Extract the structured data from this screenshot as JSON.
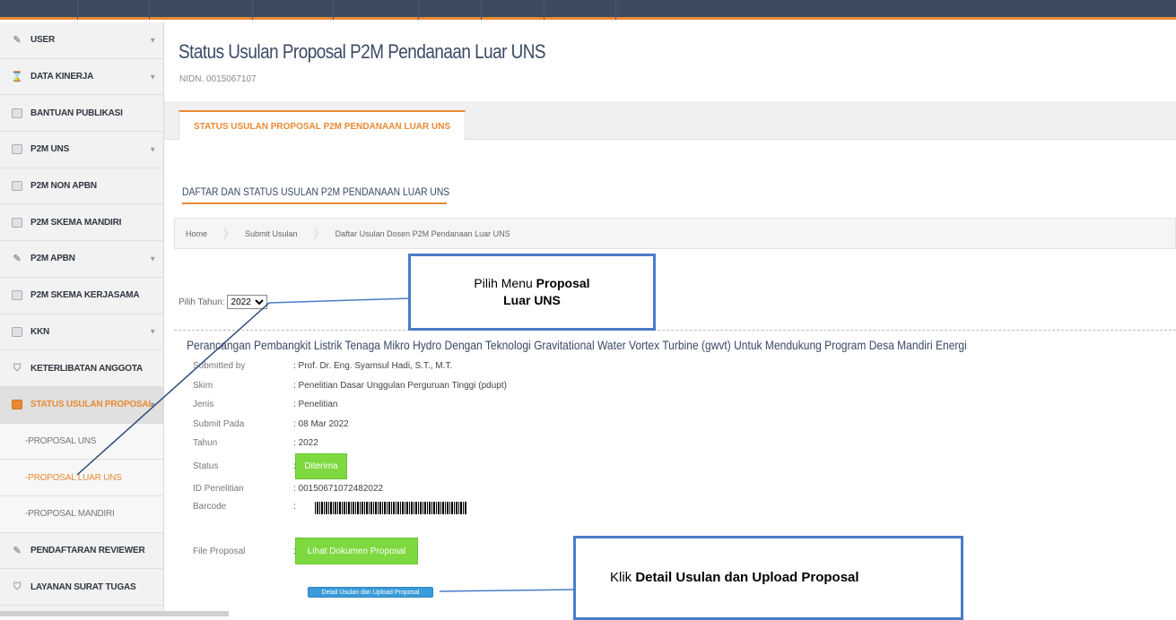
{
  "sidebar": {
    "items": [
      {
        "label": "USER",
        "icon": "pencil-icon",
        "chevron": true
      },
      {
        "label": "DATA KINERJA",
        "icon": "hourglass-icon",
        "chevron": true
      },
      {
        "label": "BANTUAN PUBLIKASI",
        "icon": "document-icon",
        "chevron": false
      },
      {
        "label": "P2M UNS",
        "icon": "document-icon",
        "chevron": true
      },
      {
        "label": "P2M NON APBN",
        "icon": "document-icon",
        "chevron": false
      },
      {
        "label": "P2M SKEMA MANDIRI",
        "icon": "document-icon",
        "chevron": false
      },
      {
        "label": "P2M APBN",
        "icon": "pencil-icon",
        "chevron": true
      },
      {
        "label": "P2M SKEMA KERJASAMA",
        "icon": "document-icon",
        "chevron": false
      },
      {
        "label": "KKN",
        "icon": "document-icon",
        "chevron": true
      },
      {
        "label": "KETERLIBATAN ANGGOTA",
        "icon": "shield-icon",
        "chevron": false
      },
      {
        "label": "STATUS USULAN PROPOSAL",
        "icon": "document-icon",
        "chevron": true
      }
    ],
    "subitems": [
      {
        "label": "PROPOSAL UNS"
      },
      {
        "label": "PROPOSAL LUAR UNS"
      },
      {
        "label": "PROPOSAL MANDIRI"
      }
    ],
    "bottom_items": [
      {
        "label": "PENDAFTARAN REVIEWER",
        "icon": "pencil-icon"
      },
      {
        "label": "LAYANAN SURAT TUGAS",
        "icon": "shield-icon"
      }
    ]
  },
  "page": {
    "title": "Status Usulan Proposal P2M Pendanaan Luar UNS",
    "nidn": "NIDN. 0015067107",
    "tab_label": "STATUS USULAN PROPOSAL P2M PENDANAAN LUAR UNS",
    "section_heading": "DAFTAR DAN STATUS USULAN P2M PENDANAAN LUAR UNS",
    "breadcrumb": [
      "Home",
      "Submit Usulan",
      "Daftar Usulan Dosen P2M Pendanaan Luar UNS"
    ],
    "year_label": "Pilih Tahun:",
    "year_value": "2022"
  },
  "proposal": {
    "title": "Perancangan Pembangkit Listrik Tenaga Mikro Hydro Dengan Teknologi Gravitational Water Vortex Turbine (gwvt) Untuk Mendukung Program Desa Mandiri Energi",
    "fields": [
      {
        "label": "Submitted by",
        "value": ": Prof. Dr. Eng. Syamsul Hadi, S.T., M.T."
      },
      {
        "label": "Skim",
        "value": ": Penelitian Dasar Unggulan Perguruan Tinggi (pdupt)"
      },
      {
        "label": "Jenis",
        "value": ": Penelitian"
      },
      {
        "label": "Submit Pada",
        "value": ": 08 Mar 2022"
      },
      {
        "label": "Tahun",
        "value": ": 2022"
      },
      {
        "label": "Status",
        "value": ":"
      },
      {
        "label": "ID Penelitian",
        "value": ": 00150671072482022"
      },
      {
        "label": "Barcode",
        "value": ":"
      },
      {
        "label": "File Proposal",
        "value": ":"
      }
    ],
    "status_button": "Diterima",
    "file_button": "Lihat Dokumen Proposal",
    "detail_button": "Detail Usulan dan Upload Proposal"
  },
  "callouts": {
    "menu_prefix": "Pilih Menu ",
    "menu_bold_1": "Proposal",
    "menu_bold_2": "Luar UNS",
    "detail_prefix": "Klik  ",
    "detail_bold": "Detail Usulan dan Upload Proposal"
  },
  "colors": {
    "accent": "#e98a33",
    "topbar": "#3d4a5f",
    "green": "#7ed940",
    "blue": "#3b9bd9",
    "callout_border": "#4a7cc7"
  }
}
